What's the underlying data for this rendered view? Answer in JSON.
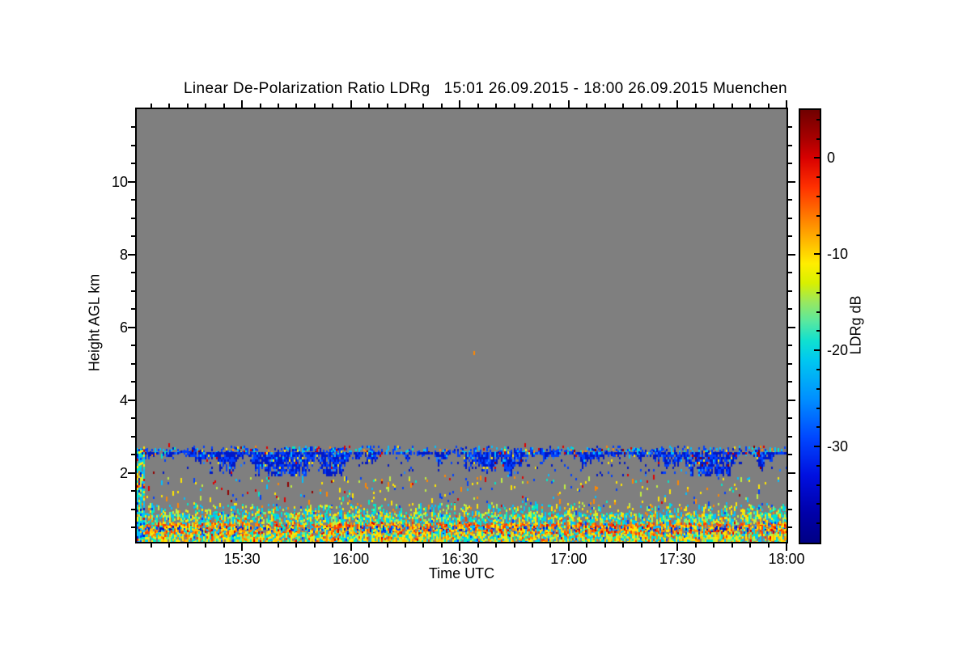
{
  "title": "Linear De-Polarization Ratio LDRg   15:01 26.09.2015 - 18:00 26.09.2015 Muenchen",
  "station": "Muenchen",
  "time_start": "15:01 26.09.2015",
  "time_end": "18:00 26.09.2015",
  "chart_data": {
    "type": "heatmap",
    "title": "Linear De-Polarization Ratio LDRg   15:01 26.09.2015 - 18:00 26.09.2015 Muenchen",
    "xlabel": "Time UTC",
    "ylabel": "Height AGL km",
    "seed": 20150926,
    "x_axis": {
      "label": "Time UTC",
      "range_minutes": [
        901,
        1080
      ],
      "major_ticks": [
        {
          "minute": 930,
          "label": "15:30"
        },
        {
          "minute": 960,
          "label": "16:00"
        },
        {
          "minute": 990,
          "label": "16:30"
        },
        {
          "minute": 1020,
          "label": "17:00"
        },
        {
          "minute": 1050,
          "label": "17:30"
        },
        {
          "minute": 1080,
          "label": "18:00"
        }
      ],
      "minor_step_minutes": 5
    },
    "y_axis": {
      "label": "Height AGL km",
      "range_km": [
        0.1,
        12
      ],
      "major_ticks": [
        {
          "km": 2,
          "label": "2"
        },
        {
          "km": 4,
          "label": "4"
        },
        {
          "km": 6,
          "label": "6"
        },
        {
          "km": 8,
          "label": "8"
        },
        {
          "km": 10,
          "label": "10"
        }
      ],
      "minor_step_km": 0.5
    },
    "colorbar": {
      "label": "LDRg dB",
      "range_db": [
        5,
        -40
      ],
      "major_ticks": [
        {
          "db": 0,
          "label": "0"
        },
        {
          "db": -10,
          "label": "-10"
        },
        {
          "db": -20,
          "label": "-20"
        },
        {
          "db": -30,
          "label": "-30"
        }
      ],
      "minor_step_db": 2,
      "gradient_anchors": [
        [
          5,
          "#700000"
        ],
        [
          2,
          "#a80000"
        ],
        [
          0,
          "#d80000"
        ],
        [
          -3,
          "#ff3000"
        ],
        [
          -6,
          "#ff7800"
        ],
        [
          -9,
          "#ffc000"
        ],
        [
          -11,
          "#ffee00"
        ],
        [
          -13,
          "#d8f000"
        ],
        [
          -15,
          "#98e860"
        ],
        [
          -17,
          "#58e8a0"
        ],
        [
          -19,
          "#10e0d0"
        ],
        [
          -21,
          "#00c8f0"
        ],
        [
          -25,
          "#0090ff"
        ],
        [
          -29,
          "#0048ff"
        ],
        [
          -33,
          "#0010e0"
        ],
        [
          -37,
          "#0000a8"
        ],
        [
          -40,
          "#000085"
        ]
      ]
    },
    "colors": {
      "nodata": "#7f7f7f",
      "palette": {
        "darkblue": "#0018c8",
        "blue": "#0040ff",
        "midblue": "#2080ff",
        "cyan": "#00c0ff",
        "turquoise": "#00e8c8",
        "lightgreen": "#70f080",
        "greenyellow": "#c0f040",
        "yellow": "#ffe800",
        "gold": "#ffc000",
        "orange": "#ff8800",
        "redorange": "#ff4000",
        "red": "#e00000",
        "darkred": "#900000"
      }
    },
    "bands": [
      {
        "name": "echo-top-speckle-row",
        "km": [
          2.56,
          2.7
        ],
        "density": 0.48,
        "mode": "uniform",
        "colors": [
          [
            "blue",
            0.45
          ],
          [
            "darkblue",
            0.15
          ],
          [
            "cyan",
            0.2
          ],
          [
            "turquoise",
            0.06
          ],
          [
            "yellow",
            0.05
          ],
          [
            "orange",
            0.04
          ],
          [
            "red",
            0.03
          ],
          [
            "darkred",
            0.02
          ]
        ]
      },
      {
        "name": "blue-cloud-layer",
        "km": [
          1.9,
          2.56
        ],
        "density": 0.95,
        "mode": "hanging",
        "colors": [
          [
            "darkblue",
            0.52
          ],
          [
            "blue",
            0.36
          ],
          [
            "midblue",
            0.05
          ],
          [
            "cyan",
            0.03
          ],
          [
            "yellow",
            0.02
          ],
          [
            "red",
            0.01
          ],
          [
            "darkred",
            0.01
          ]
        ]
      },
      {
        "name": "sparse-speckle-zone",
        "km": [
          1.12,
          1.9
        ],
        "density": 0.05,
        "mode": "uniform",
        "colors": [
          [
            "yellow",
            0.24
          ],
          [
            "orange",
            0.15
          ],
          [
            "red",
            0.13
          ],
          [
            "darkred",
            0.05
          ],
          [
            "cyan",
            0.15
          ],
          [
            "turquoise",
            0.08
          ],
          [
            "blue",
            0.1
          ],
          [
            "greenyellow",
            0.1
          ]
        ]
      },
      {
        "name": "upper-mixed-zone",
        "km": [
          0.88,
          1.12
        ],
        "density": 0.3,
        "mode": "uniform",
        "colors": [
          [
            "cyan",
            0.26
          ],
          [
            "turquoise",
            0.22
          ],
          [
            "greenyellow",
            0.14
          ],
          [
            "yellow",
            0.18
          ],
          [
            "gold",
            0.06
          ],
          [
            "orange",
            0.06
          ],
          [
            "blue",
            0.04
          ],
          [
            "lightgreen",
            0.04
          ]
        ]
      },
      {
        "name": "mid-noise-band",
        "km": [
          0.6,
          0.88
        ],
        "density": 0.68,
        "mode": "uniform",
        "colors": [
          [
            "cyan",
            0.26
          ],
          [
            "turquoise",
            0.2
          ],
          [
            "lightgreen",
            0.12
          ],
          [
            "greenyellow",
            0.12
          ],
          [
            "yellow",
            0.16
          ],
          [
            "gold",
            0.05
          ],
          [
            "orange",
            0.05
          ],
          [
            "redorange",
            0.02
          ],
          [
            "blue",
            0.02
          ]
        ]
      },
      {
        "name": "orange-streak-upper",
        "km": [
          0.5,
          0.6
        ],
        "density": 0.85,
        "mode": "uniform",
        "colors": [
          [
            "redorange",
            0.3
          ],
          [
            "orange",
            0.25
          ],
          [
            "gold",
            0.12
          ],
          [
            "yellow",
            0.12
          ],
          [
            "red",
            0.08
          ],
          [
            "cyan",
            0.06
          ],
          [
            "turquoise",
            0.04
          ],
          [
            "blue",
            0.03
          ]
        ]
      },
      {
        "name": "blue-speckle-row",
        "km": [
          0.42,
          0.5
        ],
        "density": 0.8,
        "mode": "uniform",
        "colors": [
          [
            "darkblue",
            0.2
          ],
          [
            "blue",
            0.15
          ],
          [
            "cyan",
            0.2
          ],
          [
            "yellow",
            0.2
          ],
          [
            "gold",
            0.08
          ],
          [
            "orange",
            0.07
          ],
          [
            "turquoise",
            0.1
          ]
        ]
      },
      {
        "name": "orange-streak-lower",
        "km": [
          0.34,
          0.42
        ],
        "density": 0.85,
        "mode": "uniform",
        "colors": [
          [
            "redorange",
            0.25
          ],
          [
            "orange",
            0.22
          ],
          [
            "red",
            0.1
          ],
          [
            "gold",
            0.12
          ],
          [
            "yellow",
            0.15
          ],
          [
            "cyan",
            0.08
          ],
          [
            "blue",
            0.04
          ],
          [
            "turquoise",
            0.04
          ]
        ]
      },
      {
        "name": "bottom-noise",
        "km": [
          0.1,
          0.34
        ],
        "density": 0.97,
        "mode": "uniform",
        "colors": [
          [
            "yellow",
            0.2
          ],
          [
            "gold",
            0.12
          ],
          [
            "greenyellow",
            0.14
          ],
          [
            "turquoise",
            0.14
          ],
          [
            "cyan",
            0.14
          ],
          [
            "lightgreen",
            0.08
          ],
          [
            "orange",
            0.1
          ],
          [
            "redorange",
            0.04
          ],
          [
            "red",
            0.02
          ],
          [
            "blue",
            0.02
          ]
        ]
      },
      {
        "name": "near-range-column",
        "km": [
          0.1,
          2.62
        ],
        "t_range": [
          901,
          902.8
        ],
        "density": 0.85,
        "mode": "uniform",
        "colors": [
          [
            "cyan",
            0.25
          ],
          [
            "turquoise",
            0.2
          ],
          [
            "yellow",
            0.15
          ],
          [
            "greenyellow",
            0.1
          ],
          [
            "blue",
            0.1
          ],
          [
            "darkblue",
            0.08
          ],
          [
            "orange",
            0.07
          ],
          [
            "red",
            0.05
          ]
        ]
      }
    ],
    "isolated_cells": [
      {
        "t": 994,
        "km": 5.3,
        "color": "orange"
      },
      {
        "t": 910,
        "km": 2.76,
        "color": "red"
      },
      {
        "t": 1008,
        "km": 2.78,
        "color": "red"
      }
    ]
  }
}
